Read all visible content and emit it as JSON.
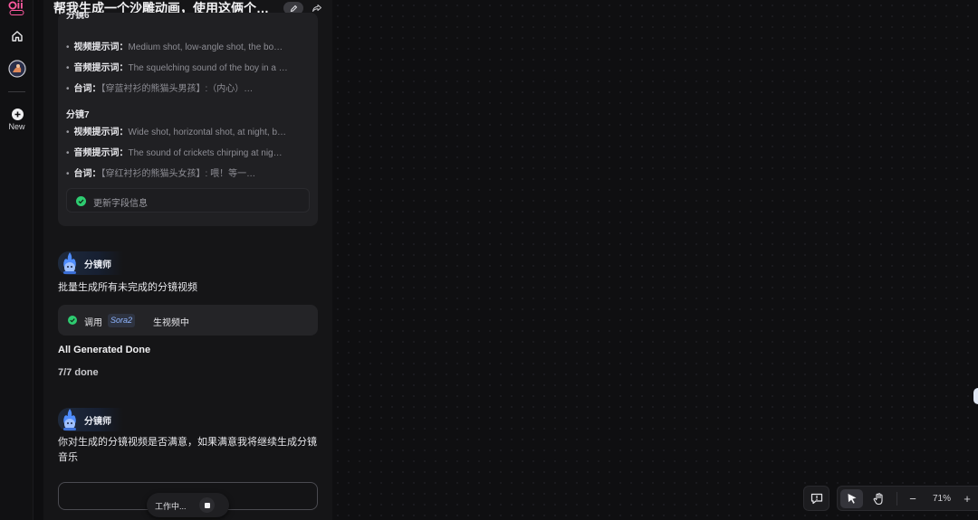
{
  "rail": {
    "new_label": "New"
  },
  "chat": {
    "title": "帮我生成一个沙雕动画，使用这俩个角色…",
    "storyboard": {
      "shot6_head": "分镜6",
      "shot6": [
        {
          "key": "视频提示词：",
          "value": "Medium shot, low-angle shot, the bo…"
        },
        {
          "key": "音频提示词：",
          "value": "The squelching sound of the boy in a …"
        },
        {
          "key": "台词：",
          "value": "【穿蓝衬衫的熊猫头男孩】:（内心）…"
        }
      ],
      "shot7_head": "分镜7",
      "shot7": [
        {
          "key": "视频提示词：",
          "value": "Wide shot, horizontal shot, at night, b…"
        },
        {
          "key": "音频提示词：",
          "value": "The sound of crickets chirping at nig…"
        },
        {
          "key": "台词：",
          "value": "【穿红衬衫的熊猫头女孩】: 喂！等一…"
        }
      ],
      "update_label": "更新字段信息"
    },
    "agent_name": "分镜师",
    "msg1": "批量生成所有未完成的分镜视频",
    "tool": {
      "prefix": "调用",
      "model": "Sora2",
      "suffix": "生视频中"
    },
    "done_title": "All Generated Done",
    "done_count": "7/7 done",
    "msg2": "你对生成的分镜视频是否满意，如果满意我将继续生成分镜音乐",
    "working_label": "工作中..."
  },
  "canvas": {
    "zoom": "71%",
    "zoom_minus": "−",
    "zoom_plus": "+"
  },
  "colors": {
    "accent_green": "#2ecc71",
    "tag_text": "#8fb5ff"
  }
}
